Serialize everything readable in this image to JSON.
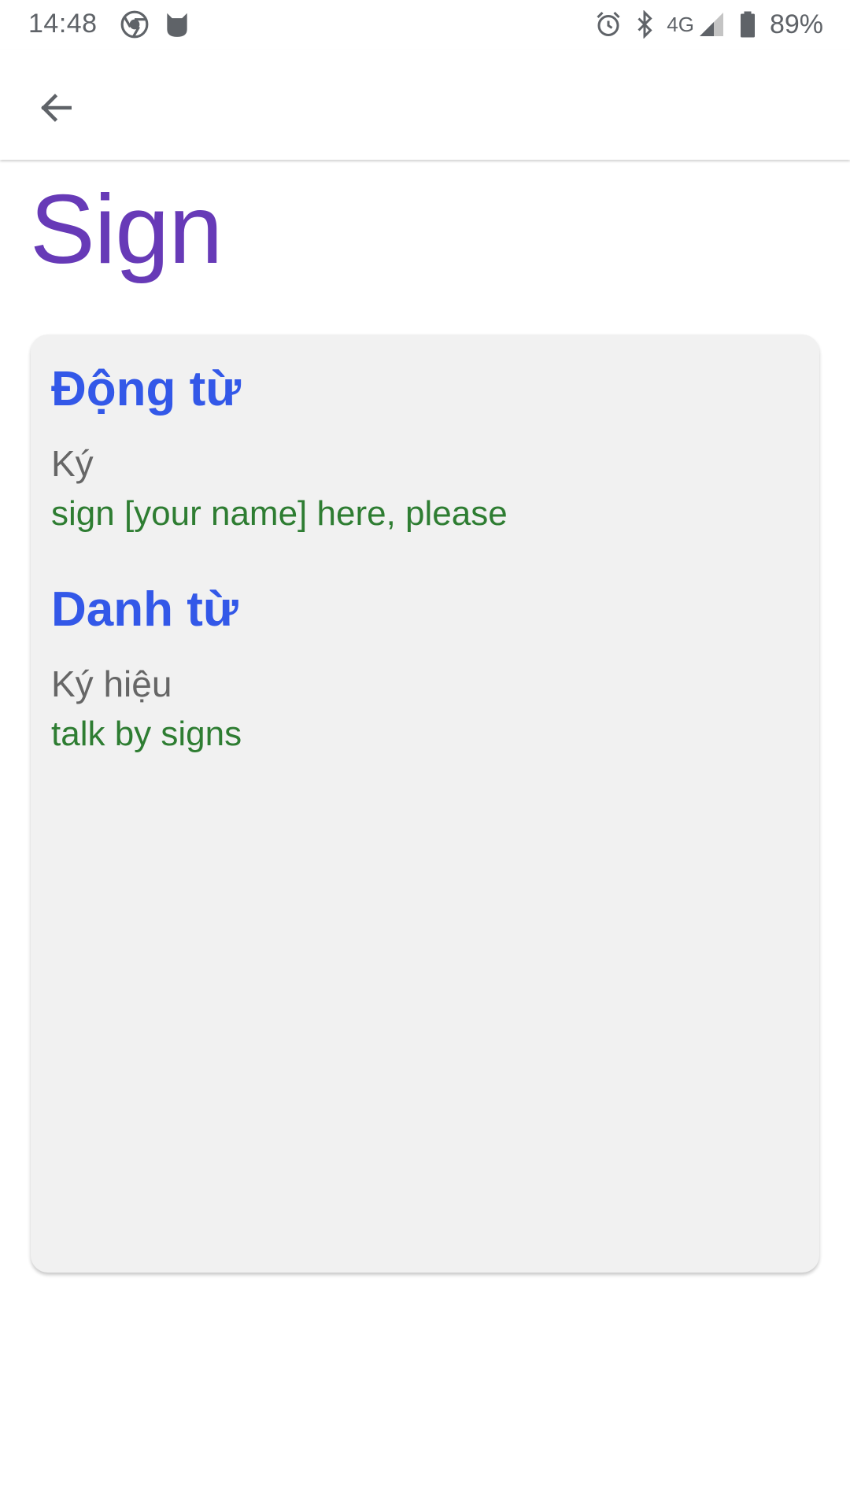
{
  "status_bar": {
    "time": "14:48",
    "left_icons": [
      "chrome-icon",
      "cat-app-icon"
    ],
    "right_icons": [
      "alarm-icon",
      "bluetooth-icon",
      "signal-icon",
      "battery-icon"
    ],
    "network": "4G",
    "battery": "89%"
  },
  "app_bar": {
    "back_icon": "arrow-back-icon"
  },
  "word": {
    "title": "Sign",
    "title_color": "#673ab7"
  },
  "definitions": [
    {
      "part_of_speech": "Động từ",
      "meaning": "Ký",
      "example": "sign [your name] here, please"
    },
    {
      "part_of_speech": "Danh từ",
      "meaning": "Ký hiệu",
      "example": "talk by signs"
    }
  ],
  "colors": {
    "heading": "#3358e8",
    "meaning": "#666666",
    "example": "#2e7d32",
    "card_bg": "#f1f1f1"
  }
}
